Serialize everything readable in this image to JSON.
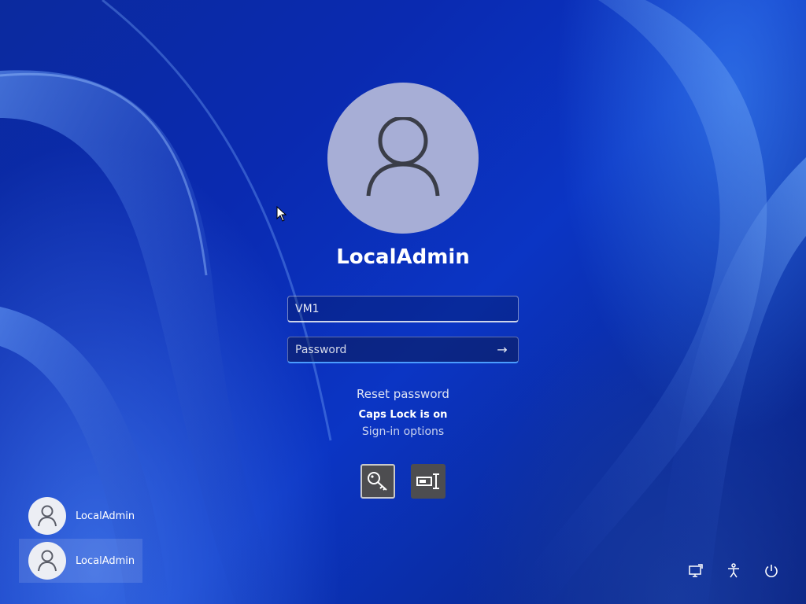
{
  "login": {
    "username": "LocalAdmin",
    "domain_value": "VM1",
    "password_placeholder": "Password",
    "submit_icon": "arrow-right-icon",
    "reset_password": "Reset password",
    "caps_lock_warning": "Caps Lock is on",
    "signin_options": "Sign-in options",
    "options": [
      {
        "name": "password-option",
        "icon": "key-icon",
        "selected": true
      },
      {
        "name": "smartcard-option",
        "icon": "smartcard-icon",
        "selected": false
      }
    ]
  },
  "user_list": [
    {
      "label": "LocalAdmin",
      "selected": false
    },
    {
      "label": "LocalAdmin",
      "selected": true
    }
  ],
  "system_tray": [
    {
      "name": "network-icon"
    },
    {
      "name": "accessibility-icon"
    },
    {
      "name": "power-icon"
    }
  ],
  "colors": {
    "background": "#0a2ab0",
    "avatar_big": "#a7aed6",
    "focus_underline": "#4a9cff",
    "option_button": "#4d4d50"
  }
}
